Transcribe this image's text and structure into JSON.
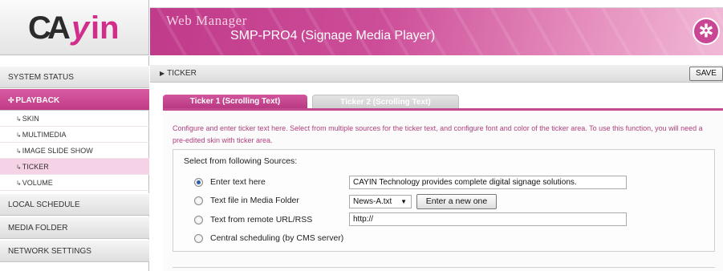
{
  "header": {
    "logo_text": "CAYIN",
    "logo_parts": [
      "C",
      "A",
      "y",
      "in"
    ],
    "title": "Web Manager",
    "subtitle": "SMP-PRO4 (Signage Media Player)",
    "brand_color": "#c94694"
  },
  "sidebar": {
    "sections": [
      {
        "label": "SYSTEM STATUS"
      },
      {
        "label": "PLAYBACK",
        "active": true
      },
      {
        "label": "LOCAL SCHEDULE"
      },
      {
        "label": "MEDIA FOLDER"
      },
      {
        "label": "NETWORK SETTINGS"
      }
    ],
    "playback_items": [
      {
        "label": "SKIN"
      },
      {
        "label": "MULTIMEDIA"
      },
      {
        "label": "IMAGE SLIDE SHOW"
      },
      {
        "label": "TICKER",
        "active": true
      },
      {
        "label": "VOLUME"
      }
    ]
  },
  "toolbar": {
    "breadcrumb": "TICKER",
    "save_label": "SAVE"
  },
  "tabs": [
    {
      "label": "Ticker 1 (Scrolling Text)",
      "active": true
    },
    {
      "label": "Ticker 2 (Scrolling Text)",
      "active": false
    }
  ],
  "main": {
    "description": "Configure and enter ticker text here. Select from multiple sources for the ticker text, and configure font and color of the ticker area. To use this function, you will need a pre-edited skin with ticker area.",
    "sources_title": "Select from following Sources:",
    "options": [
      {
        "label": "Enter text here",
        "checked": true
      },
      {
        "label": "Text file in Media Folder",
        "checked": false
      },
      {
        "label": "Text from remote URL/RSS",
        "checked": false
      },
      {
        "label": "Central scheduling (by CMS server)",
        "checked": false
      }
    ],
    "text_value": "CAYIN Technology provides complete digital signage solutions.",
    "file_select_value": "News-A.txt",
    "new_button_label": "Enter a new one",
    "url_value": "http://"
  }
}
